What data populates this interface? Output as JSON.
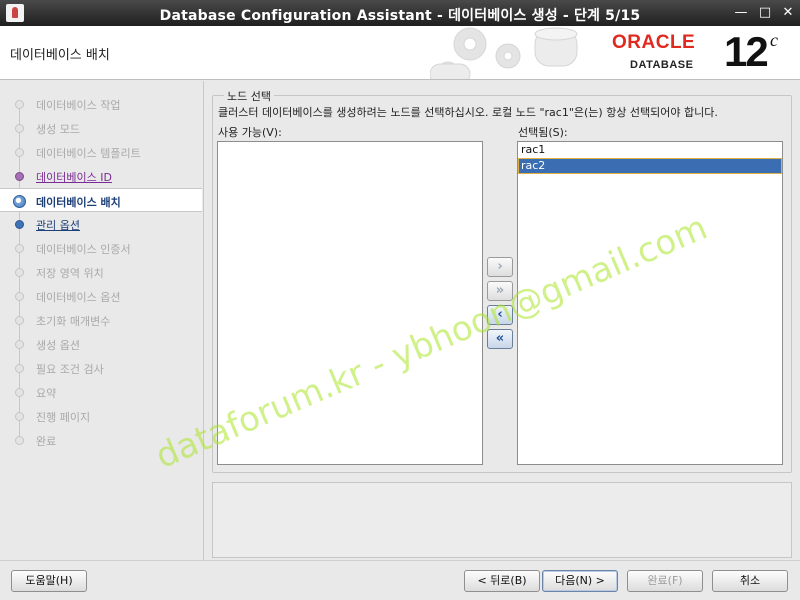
{
  "window": {
    "title": "Database Configuration Assistant - 데이터베이스 생성 - 단계 5/15"
  },
  "header": {
    "page_title": "데이터베이스 배치",
    "logo_text": "ORACLE",
    "logo_sub": "DATABASE",
    "version": "12",
    "version_suffix": "c"
  },
  "steps": [
    {
      "label": "데이터베이스 작업",
      "state": "disabled"
    },
    {
      "label": "생성 모드",
      "state": "disabled"
    },
    {
      "label": "데이터베이스 템플리트",
      "state": "disabled"
    },
    {
      "label": "데이터베이스 ID",
      "state": "done"
    },
    {
      "label": "데이터베이스 배치",
      "state": "current"
    },
    {
      "label": "관리 옵션",
      "state": "next"
    },
    {
      "label": "데이터베이스 인증서",
      "state": "disabled"
    },
    {
      "label": "저장 영역 위치",
      "state": "disabled"
    },
    {
      "label": "데이터베이스 옵션",
      "state": "disabled"
    },
    {
      "label": "초기화 매개변수",
      "state": "disabled"
    },
    {
      "label": "생성 옵션",
      "state": "disabled"
    },
    {
      "label": "필요 조건 검사",
      "state": "disabled"
    },
    {
      "label": "요약",
      "state": "disabled"
    },
    {
      "label": "진행 페이지",
      "state": "disabled"
    },
    {
      "label": "완료",
      "state": "disabled"
    }
  ],
  "node_selection": {
    "group_title": "노드 선택",
    "description": "클러스터 데이터베이스를 생성하려는 노드를 선택하십시오. 로컬 노드 \"rac1\"은(는) 항상 선택되어야 합니다.",
    "available_label": "사용 가능(V):",
    "selected_label": "선택됨(S):",
    "available_items": [],
    "selected_items": [
      "rac1",
      "rac2"
    ],
    "selected_highlight": "rac2",
    "move_buttons": {
      "move_right": "›",
      "move_all_right": "»",
      "move_left": "‹",
      "move_all_left": "«"
    }
  },
  "watermark": "dataforum.kr - ybhoon@gmail.com",
  "buttons": {
    "help": "도움말(H)",
    "back": "< 뒤로(B)",
    "next": "다음(N) >",
    "finish": "완료(F)",
    "cancel": "취소"
  },
  "colors": {
    "oracle_red": "#e02a1f",
    "selection_blue": "#3b6db3",
    "link_purple": "#7a2b93",
    "watermark_green": "#aae628"
  }
}
